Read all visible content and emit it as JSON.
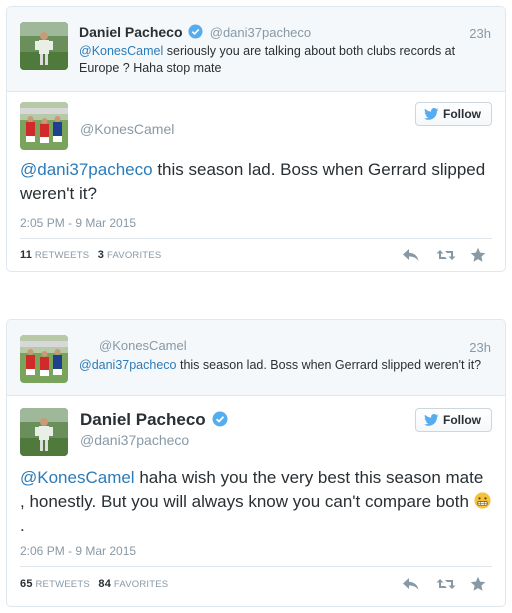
{
  "tweet1": {
    "parent": {
      "name": "Daniel Pacheco",
      "handle": "@dani37pacheco",
      "time": "23h",
      "mention": "@KonesCamel",
      "text": " seriously you are talking about both clubs records at Europe ? Haha stop mate",
      "avatar_icon": "soccer-player-avatar"
    },
    "main": {
      "handle": "@KonesCamel",
      "follow_label": "Follow",
      "mention": "@dani37pacheco",
      "text": " this season lad. Boss when Gerrard slipped weren't it?",
      "date": "2:05 PM - 9 Mar 2015",
      "retweets_count": "11",
      "retweets_label": "RETWEETS",
      "favorites_count": "3",
      "favorites_label": "FAVORITES",
      "avatar_icon": "football-team-avatar"
    }
  },
  "tweet2": {
    "parent": {
      "handle": "@KonesCamel",
      "time": "23h",
      "mention": "@dani37pacheco",
      "text": " this season lad. Boss when Gerrard slipped weren't it?",
      "avatar_icon": "football-team-avatar"
    },
    "main": {
      "name": "Daniel Pacheco",
      "handle": "@dani37pacheco",
      "follow_label": "Follow",
      "mention": "@KonesCamel",
      "text_before_emoji": " haha wish you the very best this season mate , honestly. But you will always know you can't compare both ",
      "text_after_emoji": ".",
      "date": "2:06 PM - 9 Mar 2015",
      "retweets_count": "65",
      "retweets_label": "RETWEETS",
      "favorites_count": "84",
      "favorites_label": "FAVORITES",
      "avatar_icon": "soccer-player-avatar"
    }
  },
  "colors": {
    "link": "#2b7bb9",
    "muted": "#8899a6",
    "text": "#292f33",
    "verified": "#55acee",
    "border": "#e1e8ed"
  }
}
